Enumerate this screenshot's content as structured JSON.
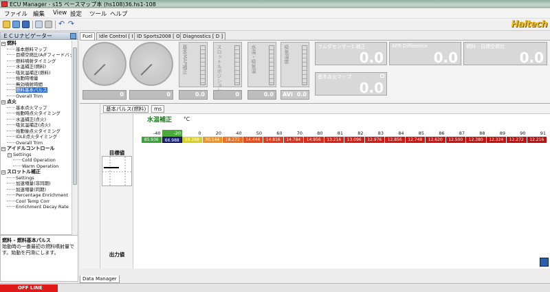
{
  "window": {
    "title": "ECU Manager - s15  ベースマップ本 (hs108)36.hs1-108"
  },
  "menu": [
    "ファイル",
    "編集",
    "View",
    "設定",
    "ツール",
    "ヘルプ"
  ],
  "logo": "Haltech",
  "nav": {
    "header": "ＥＣＵナビゲーター",
    "items": [
      {
        "label": "燃料",
        "level": 0,
        "group": true
      },
      {
        "label": "基本燃料マップ",
        "level": 1
      },
      {
        "label": "目標空燃比(A/Fフィードバック)",
        "level": 1
      },
      {
        "label": "燃料噴射タイミング",
        "level": 1
      },
      {
        "label": "水温補正(燃料)",
        "level": 1
      },
      {
        "label": "吸気温補正(燃料)",
        "level": 1
      },
      {
        "label": "始動時増量",
        "level": 1
      },
      {
        "label": "無効噴射時間",
        "level": 1
      },
      {
        "label": "燃料基本パルス",
        "level": 1,
        "selected": true
      },
      {
        "label": "Overall Trim",
        "level": 1
      },
      {
        "label": "点火",
        "level": 0,
        "group": true
      },
      {
        "label": "基本点火マップ",
        "level": 1
      },
      {
        "label": "始動時点火タイミング",
        "level": 1
      },
      {
        "label": "水温補正(点火)",
        "level": 1
      },
      {
        "label": "吸気温補正(点火)",
        "level": 1
      },
      {
        "label": "始動後点火タイミング",
        "level": 1
      },
      {
        "label": "IDLE点火タイミング",
        "level": 1
      },
      {
        "label": "Overall Trim",
        "level": 1
      },
      {
        "label": "アイドルコントロール",
        "level": 0,
        "group": true
      },
      {
        "label": "Settings",
        "level": 1,
        "group": true
      },
      {
        "label": "Cold Operation",
        "level": 2
      },
      {
        "label": "Warm Operation",
        "level": 2
      },
      {
        "label": "スロットル補正",
        "level": 0,
        "group": true
      },
      {
        "label": "Settings",
        "level": 1
      },
      {
        "label": "加速増量(非同期)",
        "level": 1
      },
      {
        "label": "加速増量(同期)",
        "level": 1
      },
      {
        "label": "Percentage Enrichment",
        "level": 1
      },
      {
        "label": "Cool Temp Corr",
        "level": 1
      },
      {
        "label": "Enrichment Decay Rate",
        "level": 1
      }
    ]
  },
  "description": {
    "title": "燃料 - 燃料基本パルス",
    "text": "始動時の一番最初の燃料噴射量です。始動を円滑にします。"
  },
  "tabs": [
    "Fuel",
    "Idle Control [ I ]",
    "ID Sports2008 [ O ]",
    "Diagnostics [ D ]"
  ],
  "gauges": {
    "dial1_value": "0",
    "dial2_value": "0",
    "bar_labels": [
      "基本MAP補正",
      "スロットルポジション",
      "水温・吸気温",
      "吸気温度"
    ],
    "bar_values": [
      "0.0",
      "0",
      "0.0",
      "0.0"
    ],
    "avi_label": "AVI",
    "boxes": [
      {
        "label": "ラムダセンサー1 補正",
        "value": "0.0"
      },
      {
        "label": "AFR Difference",
        "value": "0.0"
      },
      {
        "label": "燃料 - 目標空燃比",
        "value": "0.0"
      },
      {
        "label": "基本点火マップ",
        "value": "0.0"
      }
    ]
  },
  "map": {
    "subtabs": [
      "基本パルス(燃料)",
      "ms"
    ],
    "axis_name": "水温補正",
    "axis_unit": "°C",
    "row_label_top": "目標値",
    "row_label_bottom": "出力値",
    "columns": [
      "-40",
      "-20",
      "0",
      "20",
      "40",
      "50",
      "60",
      "70",
      "80",
      "81",
      "82",
      "83",
      "84",
      "85",
      "86",
      "87",
      "88",
      "89",
      "90",
      "91"
    ],
    "values": [
      "85.936",
      "66.988",
      "58.288",
      "30.144",
      "18.272",
      "14.444",
      "14.816",
      "14.784",
      "14.956",
      "13.216",
      "13.096",
      "12.976",
      "12.856",
      "12.748",
      "12.620",
      "12.500",
      "12.380",
      "12.324",
      "12.272",
      "12.216"
    ],
    "highlight_column": 1,
    "cell_colors": [
      "#3aa53a",
      "#1a237e",
      "#d9d21c",
      "#f09424",
      "#f07020",
      "#e84c1c",
      "#e63a1a",
      "#e22e1a",
      "#de2818",
      "#da2216",
      "#d71e15",
      "#d41b14",
      "#d11913",
      "#cf1712",
      "#cc1511",
      "#ca1410",
      "#c8130f",
      "#c6120f",
      "#c4110e",
      "#c2100e"
    ]
  },
  "bottom_tab": "Data Manager",
  "status": "OFF LINE"
}
